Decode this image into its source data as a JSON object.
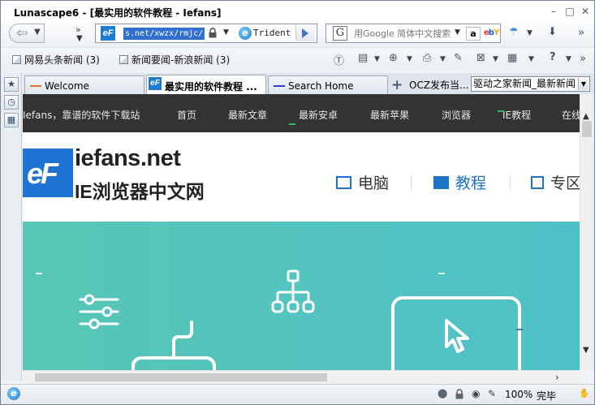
{
  "window": {
    "title": "Lunascape6 - [最实用的软件教程 - Iefans]",
    "minimize_glyph": "–",
    "maximize_glyph": "□",
    "close_glyph": "✕"
  },
  "nav": {
    "back_glyph": "⇦",
    "dropdown_glyph": "▼",
    "more_glyph": "»",
    "address_text": "s.net/xwzx/rmjc/",
    "engine_glyph": "e",
    "engine_label": "Trident",
    "favicon_text": "eF",
    "search_placeholder": "用Google 简体中文搜索",
    "search_engine_glyph": "G",
    "amazon_glyph": "a",
    "ebay_glyph": "ebY",
    "toolbar_glyphs": {
      "umbrella": "☂",
      "download": "⬇",
      "more": "»"
    }
  },
  "bookmarks": [
    {
      "label": "网易头条新闻 (3)"
    },
    {
      "label": "新闻要闻-新浪新闻 (3)"
    }
  ],
  "bookmark_more_glyph": "»",
  "toolbar2_glyphs": {
    "tv": "Ⓣ",
    "page": "▤",
    "tab_add": "⊕",
    "print": "⎙",
    "tools": "✎",
    "close_x": "⊠",
    "layout": "▦",
    "help": "?"
  },
  "side_panel": {
    "star_glyph": "★",
    "history_glyph": "◷",
    "feed_glyph": "▦"
  },
  "tabs": [
    {
      "label": "Welcome",
      "color": "#e2702a",
      "active": false
    },
    {
      "label": "最实用的软件教程 ...",
      "color": "#1e7ad2",
      "active": true
    },
    {
      "label": "Search Home",
      "color": "#2b3fd1",
      "active": false
    }
  ],
  "new_tab_glyph": "+",
  "tab_overflow_label": "OCZ发布当...",
  "tab_select_value": "驱动之家新闻_最新新闻",
  "site": {
    "nav_items": [
      "Iefans，靠谱的软件下载站",
      "首页",
      "最新文章",
      "最新安卓",
      "最新苹果",
      "浏览器",
      "IE教程",
      "在线"
    ],
    "logo_mark": "eF",
    "logo_en": "iefans.net",
    "logo_cn": "IE浏览器中文网",
    "categories": [
      {
        "label": "电脑",
        "highlight": false
      },
      {
        "label": "教程",
        "highlight": true
      },
      {
        "label": "专区",
        "highlight": false
      }
    ],
    "accent": "#1c74c9",
    "hero_color": "#56c4bc"
  },
  "scrollbar": {
    "up_glyph": "▲",
    "down_glyph": "▼",
    "left_glyph": "‹",
    "right_glyph": "›"
  },
  "status": {
    "zoom": "100%",
    "done": "完毕",
    "icons": {
      "shield": "⬤",
      "lock": "🔒",
      "eye": "◉",
      "pencil": "✎",
      "cursor": "✋"
    }
  }
}
